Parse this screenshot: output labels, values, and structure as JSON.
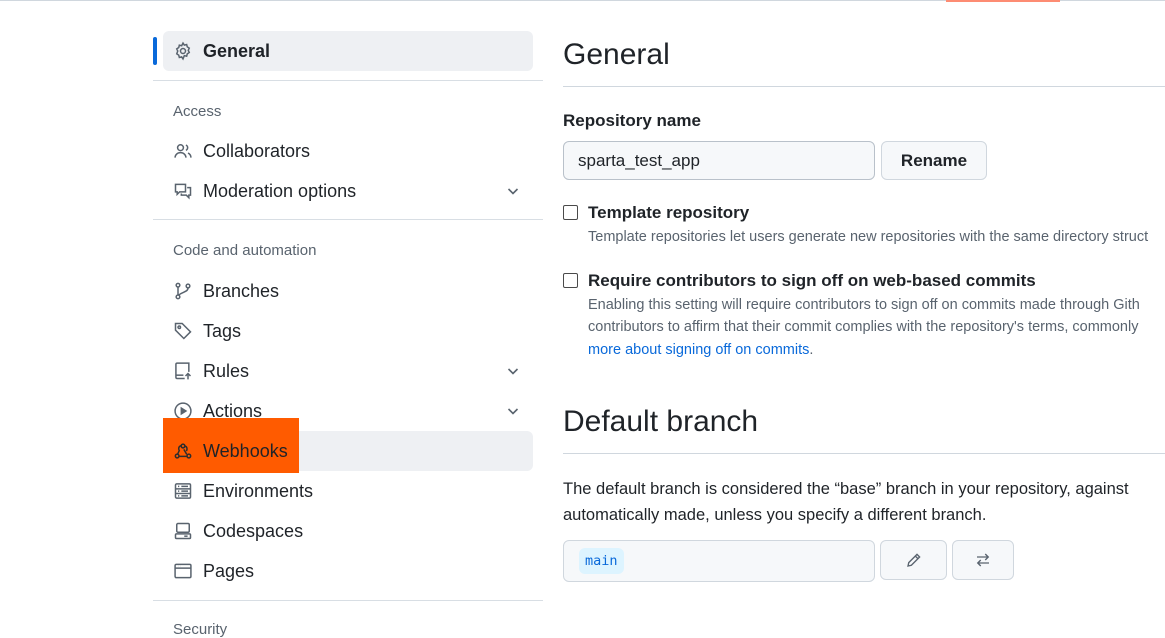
{
  "sidebar": {
    "general": {
      "label": "General",
      "icon": "gear-icon"
    },
    "groups": {
      "access": "Access",
      "code_automation": "Code and automation",
      "security": "Security"
    },
    "items": {
      "collaborators": {
        "label": "Collaborators",
        "icon": "people-icon"
      },
      "moderation": {
        "label": "Moderation options",
        "icon": "comment-discussion-icon"
      },
      "branches": {
        "label": "Branches",
        "icon": "git-branch-icon"
      },
      "tags": {
        "label": "Tags",
        "icon": "tag-icon"
      },
      "rules": {
        "label": "Rules",
        "icon": "repo-push-icon"
      },
      "actions": {
        "label": "Actions",
        "icon": "play-icon"
      },
      "webhooks": {
        "label": "Webhooks",
        "icon": "webhook-icon"
      },
      "environments": {
        "label": "Environments",
        "icon": "server-icon"
      },
      "codespaces": {
        "label": "Codespaces",
        "icon": "codespaces-icon"
      },
      "pages": {
        "label": "Pages",
        "icon": "browser-icon"
      }
    }
  },
  "main": {
    "title": "General",
    "repo_name": {
      "label": "Repository name",
      "value": "sparta_test_app",
      "rename_label": "Rename"
    },
    "template": {
      "title": "Template repository",
      "desc": "Template repositories let users generate new repositories with the same directory struct"
    },
    "signoff": {
      "title": "Require contributors to sign off on web-based commits",
      "desc_line1": "Enabling this setting will require contributors to sign off on commits made through Gith",
      "desc_line2": "contributors to affirm that their commit complies with the repository's terms, commonly",
      "link": "more about signing off on commits",
      "link_suffix": "."
    },
    "default_branch": {
      "title": "Default branch",
      "desc_line1": "The default branch is considered the “base” branch in your repository, against",
      "desc_line2": "automatically made, unless you specify a different branch.",
      "branch": "main"
    }
  },
  "colors": {
    "accent": "#0969da",
    "highlight": "#ff5b00",
    "tab_underline": "#fd8c73"
  }
}
